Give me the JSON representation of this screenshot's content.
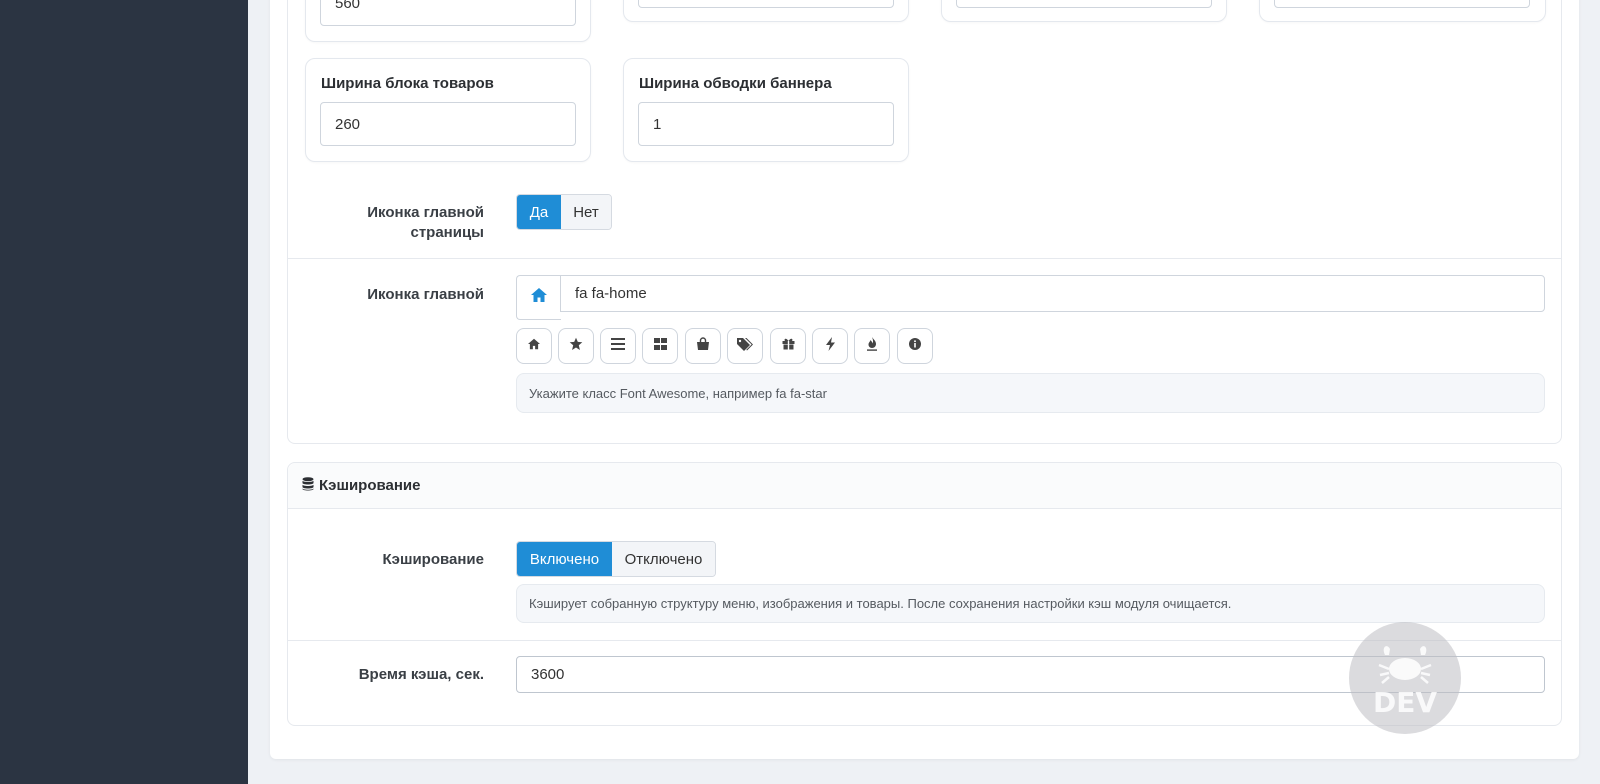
{
  "display_settings": {
    "row_top": {
      "first_value": "560"
    },
    "row_bottom": [
      {
        "label": "Ширина блока товаров",
        "value": "260"
      },
      {
        "label": "Ширина обводки баннера",
        "value": "1"
      }
    ],
    "home_icon_toggle": {
      "label": "Иконка главной страницы",
      "options": [
        "Да",
        "Нет"
      ],
      "selected": "Да"
    },
    "home_icon_class": {
      "label": "Иконка главной",
      "value": "fa fa-home",
      "preview_icon": "home-icon",
      "quick_icons": [
        "home-icon",
        "star-icon",
        "bars-icon",
        "grid-icon",
        "shopping-bag-icon",
        "tags-icon",
        "gift-icon",
        "bolt-icon",
        "fire-icon",
        "info-icon"
      ],
      "hint": "Укажите класс Font Awesome, например fa fa-star"
    }
  },
  "caching": {
    "section_title": "Кэширование",
    "section_icon": "database-icon",
    "toggle": {
      "label": "Кэширование",
      "options": [
        "Включено",
        "Отключено"
      ],
      "selected": "Включено"
    },
    "hint": "Кэширует собранную структуру меню, изображения и товары. После сохранения настройки кэш модуля очищается.",
    "ttl": {
      "label": "Время кэша, сек.",
      "value": "3600"
    }
  },
  "watermark": {
    "text": "DEV"
  },
  "colors": {
    "accent": "#1f8dd6",
    "sidebar": "#2b3442"
  }
}
